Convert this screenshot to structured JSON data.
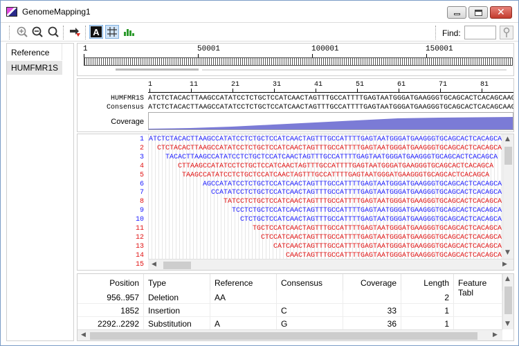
{
  "window": {
    "title": "GenomeMapping1",
    "close_glyph": "✕"
  },
  "toolbar": {
    "find_label": "Find:",
    "find_value": ""
  },
  "left_panel": {
    "header": "Reference",
    "items": [
      "HUMFMR1S"
    ]
  },
  "overview": {
    "labels": [
      "1",
      "50001",
      "100001",
      "150001"
    ]
  },
  "sequence": {
    "ruler": [
      "1",
      "11",
      "21",
      "31",
      "41",
      "51",
      "61",
      "71",
      "81"
    ],
    "rows": [
      {
        "label": "HUMFMR1S",
        "seq": "ATCTCTACACTTAAGCCATATCCTCTGCTCCATCAACTAGTTTGCCATTTTGAGTAATGGGATGAAGGGTGCAGCACTCACAGCAAGC"
      },
      {
        "label": "Consensus",
        "seq": "ATCTCTACACTTAAGCCATATCCTCTGCTCCATCAACTAGTTTGCCATTTTGAGTAATGGGATGAAGGGTGCAGCACTCACAGCAAGC"
      }
    ],
    "coverage_label": "Coverage"
  },
  "reads": [
    {
      "num": "1",
      "offset": 0,
      "color": "#1a1aff",
      "seq": "ATCTCTACACTTAAGCCATATCCTCTGCTCCATCAACTAGTTTGCCATTTTGAGTAATGGGATGAAGGGTGCAGCACTCACAGCA"
    },
    {
      "num": "2",
      "offset": 2,
      "color": "#e01010",
      "seq": "CTCTACACTTAAGCCATATCCTCTGCTCCATCAACTAGTTTGCCATTTTGAGTAATGGGATGAAGGGTGCAGCACTCACAGCA"
    },
    {
      "num": "3",
      "offset": 4,
      "color": "#1a1aff",
      "seq": "TACACTTAAGCCATATCCTCTGCTCCATCAACTAGTTTGCCATTTTGAGTAATGGGATGAAGGGTGCAGCACTCACAGCA"
    },
    {
      "num": "4",
      "offset": 7,
      "color": "#e01010",
      "seq": "CTTAAGCCATATCCTCTGCTCCATCAACTAGTTTGCCATTTTGAGTAATGGGATGAAGGGTGCAGCACTCACAGCA"
    },
    {
      "num": "5",
      "offset": 8,
      "color": "#e01010",
      "seq": "TAAGCCATATCCTCTGCTCCATCAACTAGTTTGCCATTTTGAGTAATGGGATGAAGGGTGCAGCACTCACAGCA"
    },
    {
      "num": "6",
      "offset": 13,
      "color": "#1a1aff",
      "seq": "AGCCATATCCTCTGCTCCATCAACTAGTTTGCCATTTTGAGTAATGGGATGAAGGGTGCAGCACTCACAGCA"
    },
    {
      "num": "7",
      "offset": 15,
      "color": "#1a1aff",
      "seq": "CCATATCCTCTGCTCCATCAACTAGTTTGCCATTTTGAGTAATGGGATGAAGGGTGCAGCACTCACAGCA"
    },
    {
      "num": "8",
      "offset": 18,
      "color": "#e01010",
      "seq": "TATCCTCTGCTCCATCAACTAGTTTGCCATTTTGAGTAATGGGATGAAGGGTGCAGCACTCACAGCA"
    },
    {
      "num": "9",
      "offset": 20,
      "color": "#1a1aff",
      "seq": "TCCTCTGCTCCATCAACTAGTTTGCCATTTTGAGTAATGGGATGAAGGGTGCAGCACTCACAGCA"
    },
    {
      "num": "10",
      "offset": 22,
      "color": "#1a1aff",
      "seq": "CTCTGCTCCATCAACTAGTTTGCCATTTTGAGTAATGGGATGAAGGGTGCAGCACTCACAGCA"
    },
    {
      "num": "11",
      "offset": 25,
      "color": "#e01010",
      "seq": "TGCTCCATCAACTAGTTTGCCATTTTGAGTAATGGGATGAAGGGTGCAGCACTCACAGCA"
    },
    {
      "num": "12",
      "offset": 27,
      "color": "#e01010",
      "seq": "CTCCATCAACTAGTTTGCCATTTTGAGTAATGGGATGAAGGGTGCAGCACTCACAGCA"
    },
    {
      "num": "13",
      "offset": 30,
      "color": "#e01010",
      "seq": "CATCAACTAGTTTGCCATTTTGAGTAATGGGATGAAGGGTGCAGCACTCACAGCA"
    },
    {
      "num": "14",
      "offset": 33,
      "color": "#e01010",
      "seq": "CAACTAGTTTGCCATTTTGAGTAATGGGATGAAGGGTGCAGCACTCACAGCA"
    },
    {
      "num": "15",
      "offset": 0,
      "color": "#e01010",
      "seq": ""
    }
  ],
  "table": {
    "columns": [
      "Position",
      "Type",
      "Reference",
      "Consensus",
      "Coverage",
      "Length",
      "Feature Tabl"
    ],
    "rows": [
      [
        "956..957",
        "Deletion",
        "AA",
        "",
        "",
        "2",
        ""
      ],
      [
        "1852",
        "Insertion",
        "",
        "C",
        "33",
        "1",
        ""
      ],
      [
        "2292..2292",
        "Substitution",
        "A",
        "G",
        "36",
        "1",
        ""
      ]
    ]
  }
}
